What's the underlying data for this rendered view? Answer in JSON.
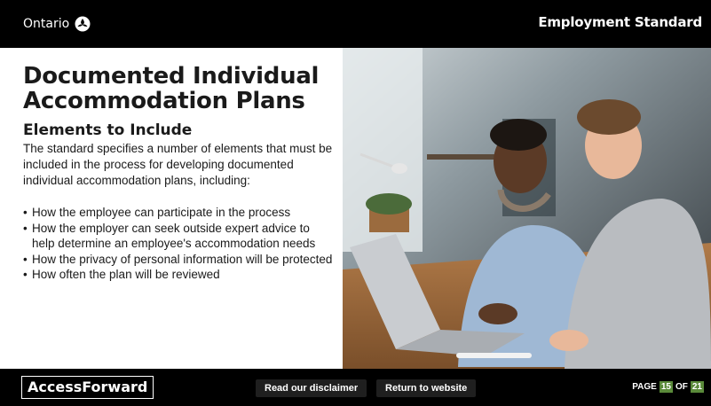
{
  "header": {
    "logo_text": "Ontario",
    "logo_icon": "trillium-icon",
    "course_title": "Employment Standard"
  },
  "content": {
    "title": "Documented Individual Accommodation Plans",
    "subtitle": "Elements to Include",
    "intro": "The standard specifies a number of elements that must be included in the process for developing documented individual accommodation plans, including:",
    "bullets": [
      "How the employee can participate in the process",
      "How the employer can seek outside expert advice to help determine an employee's accommodation needs",
      "How the privacy of personal information will be protected",
      "How often the plan will be reviewed"
    ]
  },
  "footer": {
    "brand": "AccessForward",
    "disclaimer_label": "Read our disclaimer",
    "return_label": "Return to website",
    "page_prefix": "PAGE",
    "page_current": "15",
    "page_of": "OF",
    "page_total": "21"
  },
  "colors": {
    "bar_background": "#000000",
    "page_number_badge": "#5a8a3a"
  }
}
